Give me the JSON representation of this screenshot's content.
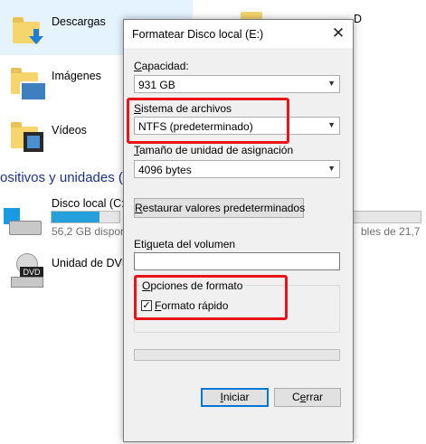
{
  "explorer": {
    "folders": [
      {
        "label": "Descargas"
      },
      {
        "label": "Imágenes"
      },
      {
        "label": "Vídeos"
      }
    ],
    "right_folder_label": "D",
    "section_title": "ositivos y unidades (",
    "drives": [
      {
        "label": "Disco local (C:)",
        "detail": "56,2 GB disponi",
        "right_detail": "bles de 21,7",
        "used_fraction": 0.7
      },
      {
        "label": "Unidad de DVD"
      }
    ],
    "dvd_icon_text": "DVD"
  },
  "dialog": {
    "title": "Formatear Disco local (E:)",
    "close_glyph": "✕",
    "capacity": {
      "label": "Capacidad:",
      "value": "931 GB"
    },
    "filesystem": {
      "label": "Sistema de archivos",
      "value": "NTFS (predeterminado)"
    },
    "allocation": {
      "label": "Tamaño de unidad de asignación",
      "value": "4096 bytes"
    },
    "restore_button": "Restaurar valores predeterminados",
    "volume_label": {
      "label": "Etiqueta del volumen",
      "value": ""
    },
    "format_options": {
      "label": "Opciones de formato",
      "quick_format": "Formato rápido",
      "quick_checked": true
    },
    "progress": 0,
    "start_button": "Iniciar",
    "close_button": "Cerrar"
  },
  "colors": {
    "highlight": "#e8141a",
    "accent": "#0078d7",
    "folder": "#f5d56c"
  }
}
